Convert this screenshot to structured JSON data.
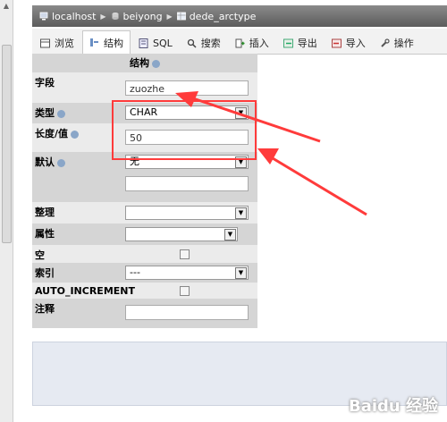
{
  "breadcrumb": {
    "items": [
      "localhost",
      "beiyong",
      "dede_arctype"
    ]
  },
  "tabs": [
    {
      "label": "浏览",
      "icon": "browse-icon"
    },
    {
      "label": "结构",
      "icon": "structure-icon",
      "active": true
    },
    {
      "label": "SQL",
      "icon": "sql-icon"
    },
    {
      "label": "搜索",
      "icon": "search-icon"
    },
    {
      "label": "插入",
      "icon": "insert-icon"
    },
    {
      "label": "导出",
      "icon": "export-icon"
    },
    {
      "label": "导入",
      "icon": "import-icon"
    },
    {
      "label": "操作",
      "icon": "wrench-icon"
    }
  ],
  "form": {
    "header": "结构",
    "field_label": "字段",
    "field_value": "zuozhe",
    "type_label": "类型",
    "type_value": "CHAR",
    "length_label": "长度/值",
    "length_value": "50",
    "default_label": "默认",
    "default_value": "无",
    "collation_label": "整理",
    "attributes_label": "属性",
    "null_label": "空",
    "index_label": "索引",
    "index_value": "---",
    "auto_increment_label": "AUTO_INCREMENT",
    "comment_label": "注释"
  },
  "colors": {
    "annotation": "#ff3b3b",
    "breadcrumb_bg": "#707070",
    "row_light": "#ebebeb",
    "row_dark": "#d5d5d5"
  },
  "watermark": "Baidu 经验"
}
